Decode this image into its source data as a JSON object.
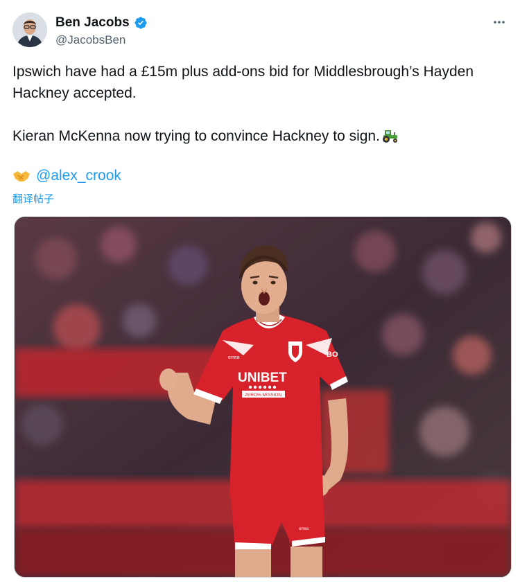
{
  "author": {
    "display_name": "Ben Jacobs",
    "handle": "@JacobsBen",
    "verified": true,
    "avatar_icon": "profile-avatar"
  },
  "more_icon": "more-options-icon",
  "tweet": {
    "paragraph1": "Ipswich have had a £15m plus add-ons bid for Middlesbrough’s Hayden Hackney accepted.",
    "paragraph2": "Kieran McKenna now trying to convince Hackney to sign.",
    "emoji2": "tractor-emoji"
  },
  "credit": {
    "emoji": "handshake-emoji",
    "mention": "@alex_crook"
  },
  "translate_label": "翻译帖子",
  "media": {
    "kind": "photo",
    "shirt_sponsor": "UNIBET",
    "shirt_sponsor_sub": "ZERO% MISSION",
    "shirt_brand": "errea",
    "sleeve_text": "BO",
    "colors": {
      "accent": "#1d9bf0",
      "shirt_red": "#d7212b"
    }
  }
}
